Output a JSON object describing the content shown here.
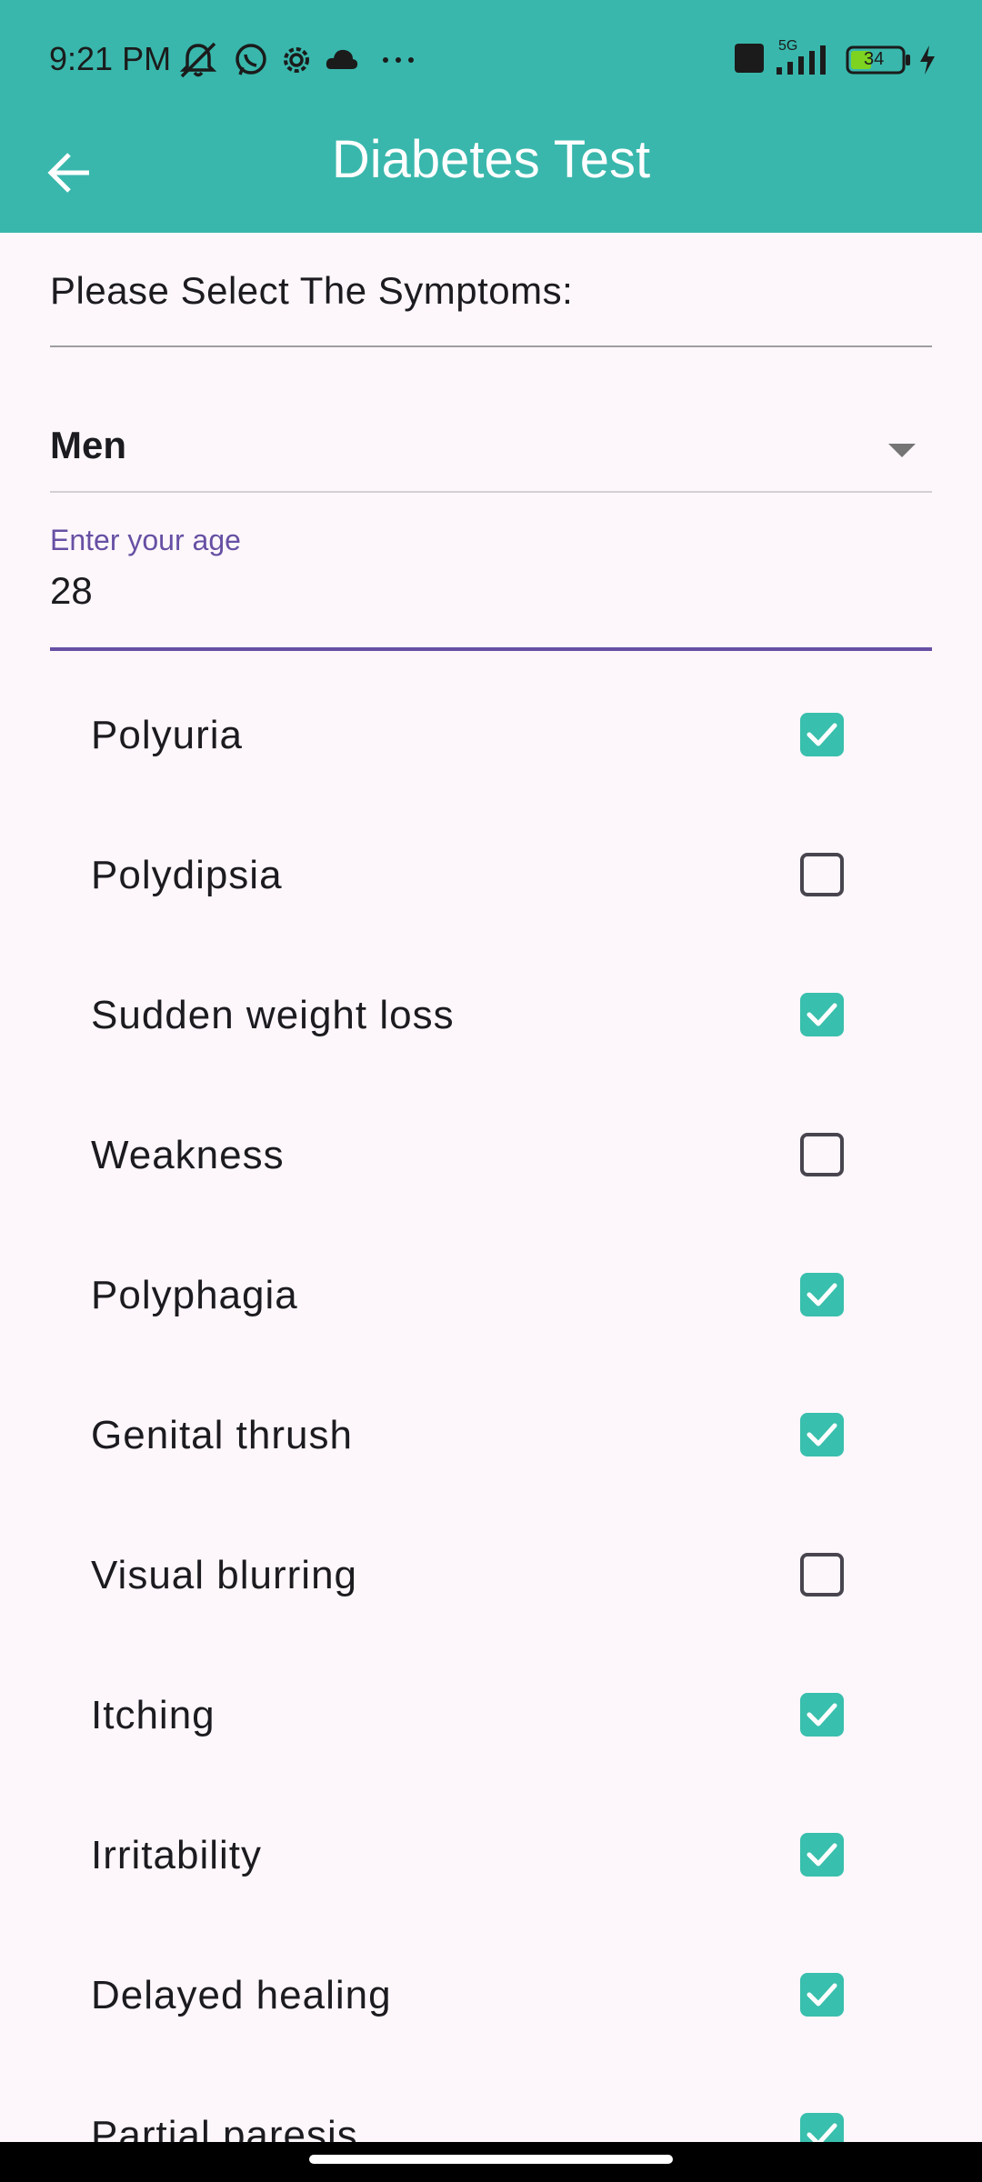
{
  "status_bar": {
    "time": "9:21 PM",
    "icons": [
      "mute-icon",
      "whatsapp-icon",
      "settings-icon",
      "cloud-icon",
      "more-icon",
      "volte-icon",
      "signal-icon",
      "battery-icon",
      "charging-icon"
    ],
    "network": "5G",
    "battery": "34"
  },
  "app_bar": {
    "title": "Diabetes Test",
    "color": "#39b7ac"
  },
  "form": {
    "section_label": "Please Select The Symptoms:",
    "gender_value": "Men",
    "age_label": "Enter your age",
    "age_value": "28"
  },
  "symptoms": [
    {
      "label": "Polyuria",
      "checked": true
    },
    {
      "label": "Polydipsia",
      "checked": false
    },
    {
      "label": "Sudden weight loss",
      "checked": true
    },
    {
      "label": "Weakness",
      "checked": false
    },
    {
      "label": "Polyphagia",
      "checked": true
    },
    {
      "label": "Genital thrush",
      "checked": true
    },
    {
      "label": "Visual blurring",
      "checked": false
    },
    {
      "label": "Itching",
      "checked": true
    },
    {
      "label": "Irritability",
      "checked": true
    },
    {
      "label": "Delayed healing",
      "checked": true
    },
    {
      "label": "Partial paresis",
      "checked": true
    }
  ]
}
